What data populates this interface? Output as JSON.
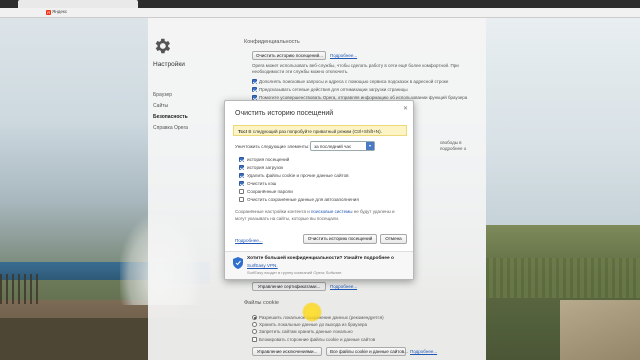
{
  "browser": {
    "bookmark_label": "Яндекс",
    "yandex_icon_glyph": "Я"
  },
  "sidebar": {
    "title": "Настройки",
    "items": [
      {
        "label": "Браузер",
        "active": false
      },
      {
        "label": "Сайты",
        "active": false
      },
      {
        "label": "Безопасность",
        "active": true
      },
      {
        "label": "Справка Opera",
        "active": false
      }
    ]
  },
  "privacy_section": {
    "title": "Конфиденциальность",
    "clear_button": "Очистить историю посещений...",
    "more_link": "Подробнее...",
    "description_line1": "Opera может использовать веб-службы, чтобы сделать работу в сети ещё более комфортной. При",
    "description_line2": "необходимости эти службы можно отключить.",
    "options": [
      {
        "label": "Дополнять поисковые запросы и адреса с помощью сервиса подсказок в адресной строке",
        "checked": true
      },
      {
        "label": "Предсказывать сетевые действия для оптимизации загрузки страницы",
        "checked": true
      },
      {
        "label": "Помогите усовершенствовать Opera, отправляя информацию об использовании функций браузера",
        "checked": true
      }
    ],
    "right_text_1": "свободы в",
    "right_text_2": "подробнее о"
  },
  "cookies_section": {
    "title": "Файлы cookie",
    "cert_button": "Управление сертификатами...",
    "cert_link": "Подробнее...",
    "radios": [
      {
        "label": "Разрешить локальное сохранение данных (рекомендуется)",
        "checked": true
      },
      {
        "label": "Хранить локальные данные до выхода из браузера",
        "checked": false
      },
      {
        "label": "Запретить сайтам хранить данные локально",
        "checked": false
      }
    ],
    "block_third_party": {
      "label": "Блокировать сторонние файлы cookie и данные сайтов",
      "checked": false
    },
    "exceptions_button": "Управление исключениями...",
    "all_cookies_button": "Все файлы cookie и данные сайтов...",
    "more_link": "Подробнее..."
  },
  "modal": {
    "title": "Очистить историю посещений",
    "close_glyph": "✕",
    "tip_bold": "Тсс!",
    "tip_text": " В следующий раз попробуйте приватный режим (Ctrl+Shift+N).",
    "period_label": "Уничтожить следующие элементы:",
    "period_value": "за последний час",
    "items": [
      {
        "label": "история посещений",
        "checked": true
      },
      {
        "label": "история загрузок",
        "checked": true
      },
      {
        "label": "Удалить файлы cookie и прочие данные сайтов",
        "checked": true
      },
      {
        "label": "Очистить кэш",
        "checked": true
      },
      {
        "label": "Сохранённые пароли",
        "checked": false
      },
      {
        "label": "Очистить сохранённые данные для автозаполнения",
        "checked": false
      }
    ],
    "note_line1_a": "Сохранённые настройки контента и ",
    "note_line1_link": "поисковые системы",
    "note_line1_b": " не будут удалены и",
    "note_line2": "могут указывать на сайты, которые вы посещали.",
    "more_link": "Подробнее...",
    "clear_button": "Очистить историю посещений",
    "cancel_button": "Отмена",
    "promo_title": "Хотите большей конфиденциальности? Узнайте подробнее о",
    "promo_link": "SurfEasy VPN.",
    "promo_sub": "SurfEasy входит в группу компаний Opera Software."
  }
}
